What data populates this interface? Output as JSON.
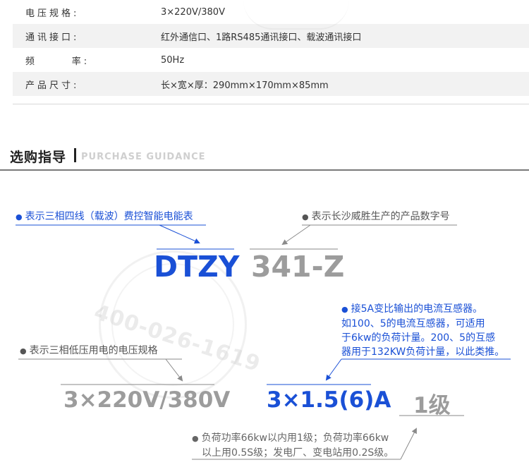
{
  "spec_table": {
    "rows": [
      {
        "label": "电压规格:",
        "value": "3×220V/380V"
      },
      {
        "label": "通讯接口:",
        "value": "红外通信口、1路RS485通讯接口、载波通讯接口"
      },
      {
        "label": "频      率:",
        "value": "50Hz"
      },
      {
        "label": "产品尺寸:",
        "value": "长×宽×厚：290mm×170mm×85mm"
      }
    ]
  },
  "section": {
    "title": "选购指导",
    "subtitle": "PURCHASE GUIDANCE"
  },
  "guidance": {
    "note_type": "表示三相四线（载波）费控智能电能表",
    "note_serial": "表示长沙威胜生产的产品数字号",
    "code_type": "DTZY",
    "code_serial": "341-Z",
    "note_voltage": "表示三相低压用电的电压规格",
    "current_note_lines": [
      "接5A变比输出的电流互感器。",
      "如100、5的电流互感器，可适用",
      "于6kw的负荷计量。200、5的互感",
      "器用于132KW负荷计量，以此类推。"
    ],
    "code_voltage": "3×220V/380V",
    "code_current": "3×1.5(6)A",
    "code_class": "1级",
    "class_note_lines": [
      "负荷功率66kw以内用1级；负荷功率66kw",
      "以上用0.5S级；发电厂、变电站用0.2S级。"
    ],
    "bullet": "●"
  },
  "watermark": {
    "phone": "400-026-1619"
  },
  "colors": {
    "accent_blue": "#1a50d6",
    "code_gray": "#9c9c9c",
    "row_shade": "#f2f2f2"
  }
}
